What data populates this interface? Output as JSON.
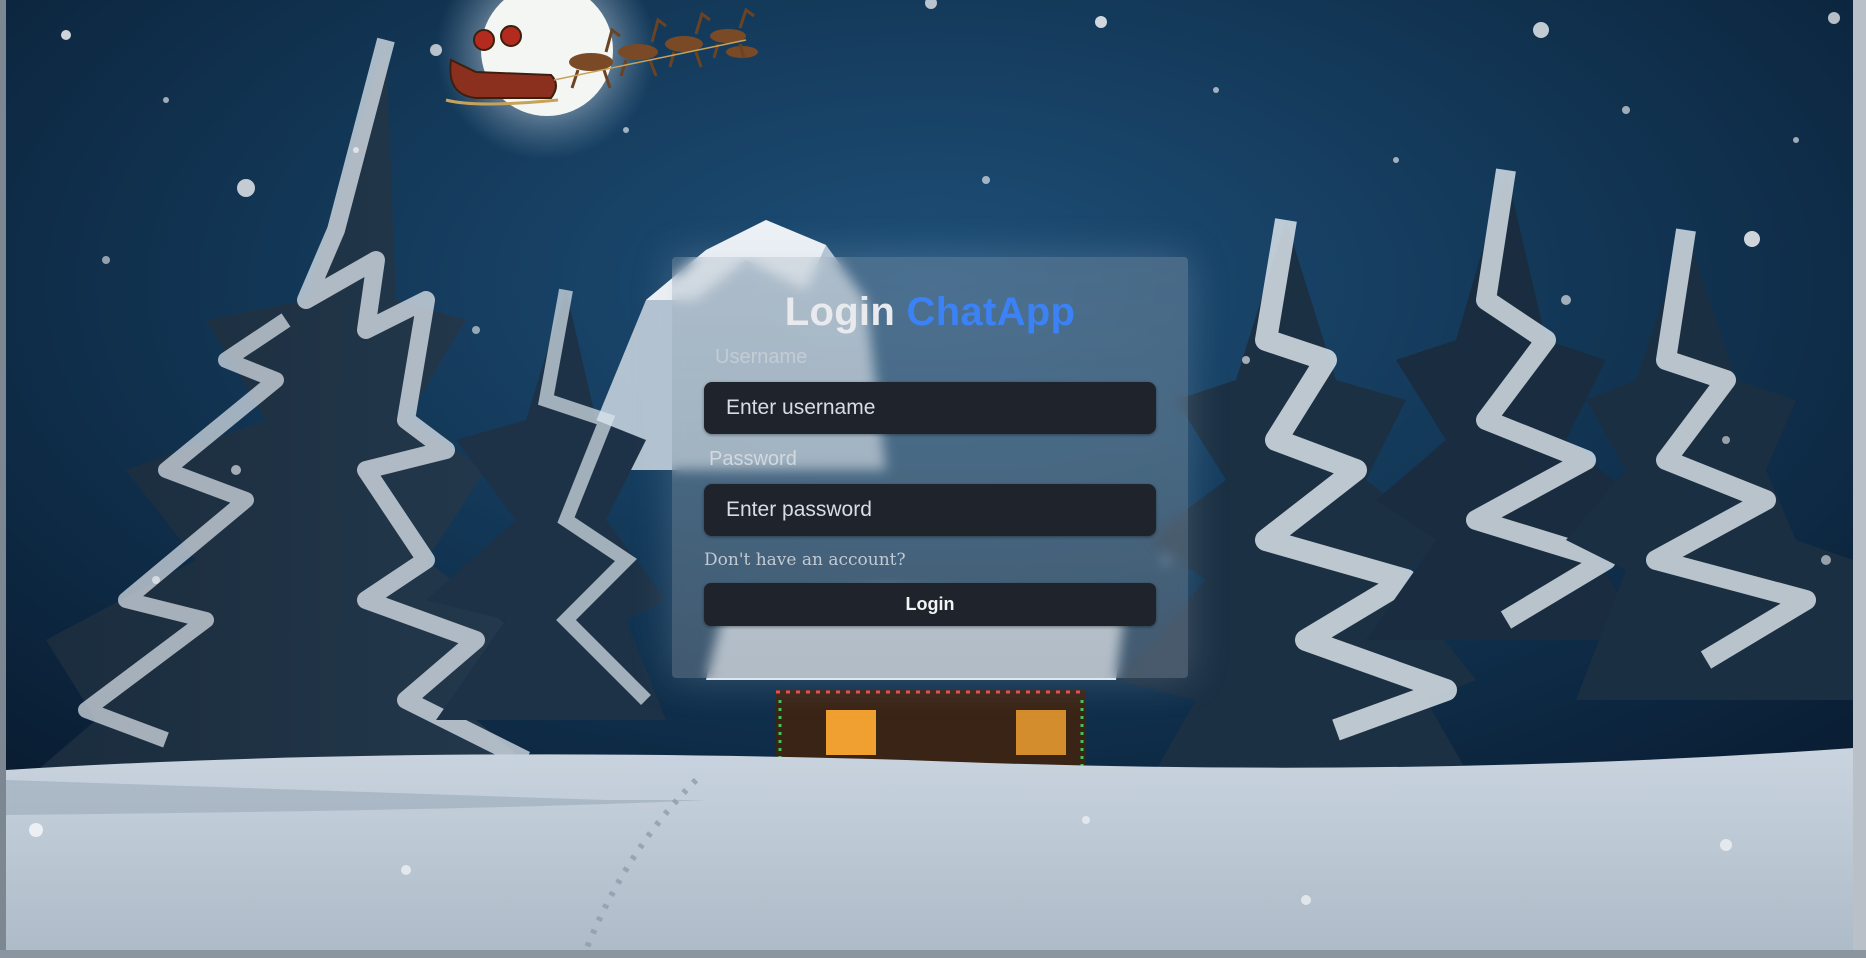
{
  "login": {
    "title_prefix": "Login",
    "title_brand": "ChatApp",
    "username_label": "Username",
    "username_placeholder": "Enter username",
    "password_label": "Password",
    "password_placeholder": "Enter password",
    "signup_link": "Don't have an account?",
    "submit_label": "Login"
  },
  "colors": {
    "brand_accent": "#3b82f6",
    "input_background": "#1f232b",
    "button_background": "#1f232b"
  },
  "background": {
    "icons": [
      "moon-icon",
      "sleigh-icon",
      "pine-tree-icon",
      "cabin-icon",
      "snowflake-icon"
    ]
  }
}
